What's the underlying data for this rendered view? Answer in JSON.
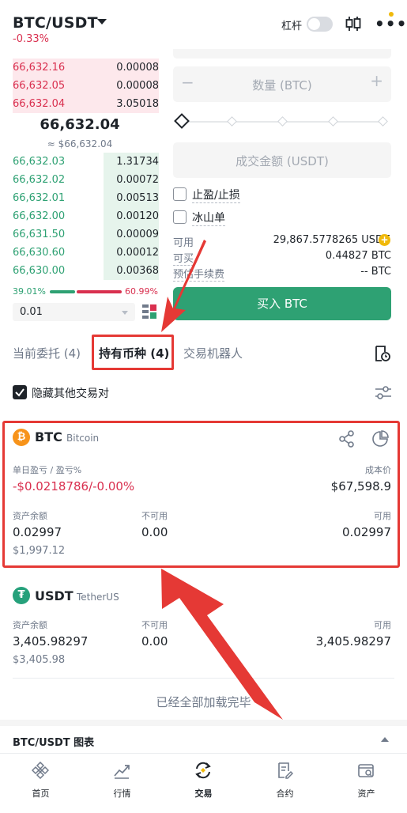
{
  "header": {
    "pair": "BTC/USDT",
    "change": "-0.33%",
    "leverage_label": "杠杆",
    "more_label": "•••"
  },
  "orderbook": {
    "asks": [
      {
        "price": "66,632.16",
        "qty": "0.00008"
      },
      {
        "price": "66,632.05",
        "qty": "0.00008"
      },
      {
        "price": "66,632.04",
        "qty": "3.05018"
      }
    ],
    "last_price": "66,632.04",
    "last_usd": "≈ $66,632.04",
    "bids": [
      {
        "price": "66,632.03",
        "qty": "1.31734"
      },
      {
        "price": "66,632.02",
        "qty": "0.00072"
      },
      {
        "price": "66,632.01",
        "qty": "0.00513"
      },
      {
        "price": "66,632.00",
        "qty": "0.00120"
      },
      {
        "price": "66,631.50",
        "qty": "0.00009"
      },
      {
        "price": "66,630.60",
        "qty": "0.00012"
      },
      {
        "price": "66,630.00",
        "qty": "0.00368"
      }
    ],
    "buy_ratio": "39.01%",
    "sell_ratio": "60.99%",
    "precision": "0.01"
  },
  "order_form": {
    "qty_placeholder": "数量 (BTC)",
    "qty_minus": "−",
    "qty_plus": "+",
    "amount_placeholder": "成交金额 (USDT)",
    "tp_sl_label": "止盈/止损",
    "iceberg_label": "冰山单",
    "available_label": "可用",
    "available_value": "29,867.5778265 USDT",
    "can_buy_label": "可买",
    "can_buy_value": "0.44827 BTC",
    "fee_label": "预估手续费",
    "fee_value": "-- BTC",
    "buy_button": "买入 BTC",
    "coin_plus": "+"
  },
  "tabs": {
    "open_orders": "当前委托 (4)",
    "holdings": "持有币种 (4)",
    "bots": "交易机器人"
  },
  "filter": {
    "hide_other_pairs": "隐藏其他交易对"
  },
  "holdings": [
    {
      "icon_glyph": "₿",
      "symbol": "BTC",
      "name": "Bitcoin",
      "pnl_label": "单日盈亏 / 盈亏%",
      "pnl_value": "-$0.0218786/-0.00%",
      "cost_label": "成本价",
      "cost_value": "$67,598.9",
      "balance_label": "资产余额",
      "balance_value": "0.02997",
      "balance_usd": "$1,997.12",
      "unavailable_label": "不可用",
      "unavailable_value": "0.00",
      "available_label": "可用",
      "available_value": "0.02997"
    },
    {
      "icon_glyph": "₮",
      "symbol": "USDT",
      "name": "TetherUS",
      "balance_label": "资产余额",
      "balance_value": "3,405.98297",
      "balance_usd": "$3,405.98",
      "unavailable_label": "不可用",
      "unavailable_value": "0.00",
      "available_label": "可用",
      "available_value": "3,405.98297"
    }
  ],
  "loaded_all": "已经全部加载完毕",
  "chart_section": "BTC/USDT 图表",
  "nav": [
    {
      "label": "首页",
      "icon": "home-icon"
    },
    {
      "label": "行情",
      "icon": "markets-icon"
    },
    {
      "label": "交易",
      "icon": "trade-icon"
    },
    {
      "label": "合约",
      "icon": "futures-icon"
    },
    {
      "label": "资产",
      "icon": "wallet-icon"
    }
  ],
  "colors": {
    "red": "#d9304f",
    "green": "#2ea173",
    "accent": "#f0b90b",
    "annotation": "#e53935"
  }
}
